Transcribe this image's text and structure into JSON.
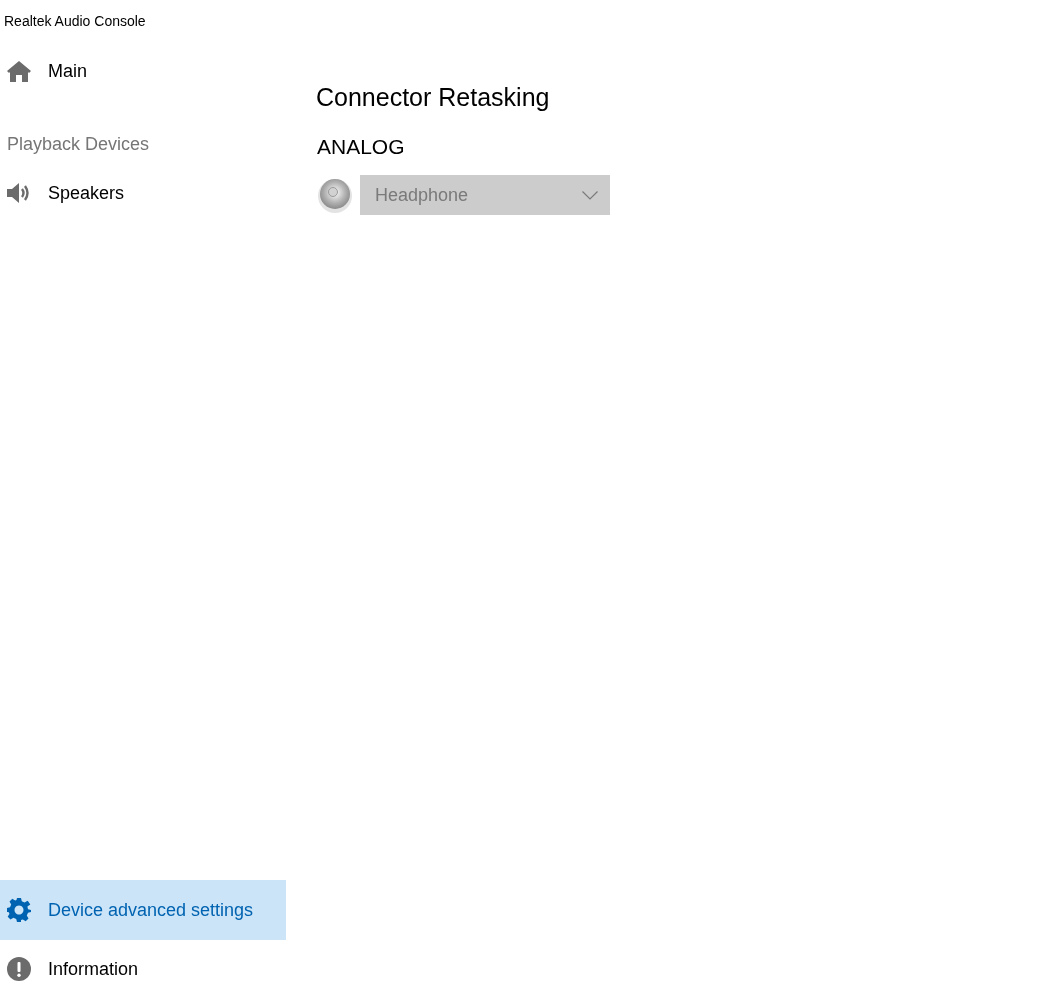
{
  "window": {
    "title": "Realtek Audio Console"
  },
  "sidebar": {
    "items": [
      {
        "kind": "nav",
        "label": "Main",
        "selected": false
      },
      {
        "kind": "header",
        "label": "Playback Devices"
      },
      {
        "kind": "nav",
        "label": "Speakers",
        "selected": false
      }
    ],
    "footer_items": [
      {
        "label": "Device advanced settings",
        "selected": true
      },
      {
        "label": "Information",
        "selected": false
      }
    ]
  },
  "content": {
    "title": "Connector Retasking",
    "sections": [
      {
        "heading": "ANALOG",
        "connectors": [
          {
            "value": "Headphone",
            "disabled": true
          }
        ]
      }
    ]
  }
}
